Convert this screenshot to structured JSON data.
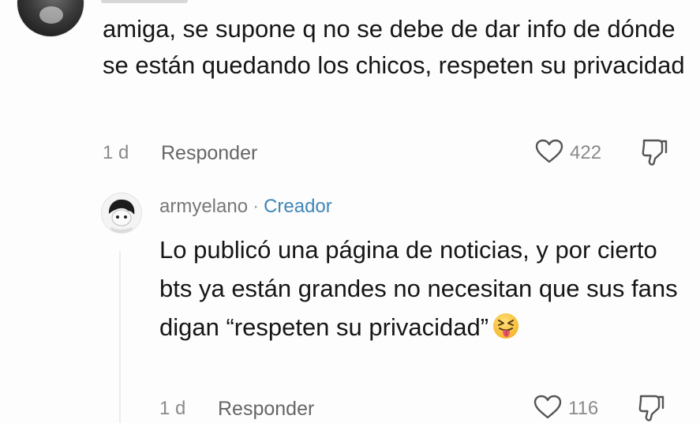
{
  "parent_comment": {
    "text": "amiga, se supone q no se debe de dar info de dónde se están quedando los chicos, respeten su privacidad",
    "time": "1 d",
    "reply_label": "Responder",
    "likes": "422"
  },
  "reply_comment": {
    "username": "armyelano",
    "separator": "·",
    "badge": "Creador",
    "text": "Lo publicó una página de noticias, y por cierto bts ya están grandes no necesitan que sus fans digan “respeten su privacidad”",
    "emoji": "😝",
    "time": "1 d",
    "reply_label": "Responder",
    "likes": "116"
  },
  "colors": {
    "creator_badge": "#3f86b8",
    "meta_text": "#8a8a8a"
  },
  "icons": {
    "like": "heart-outline-icon",
    "dislike": "thumbs-down-outline-icon"
  }
}
